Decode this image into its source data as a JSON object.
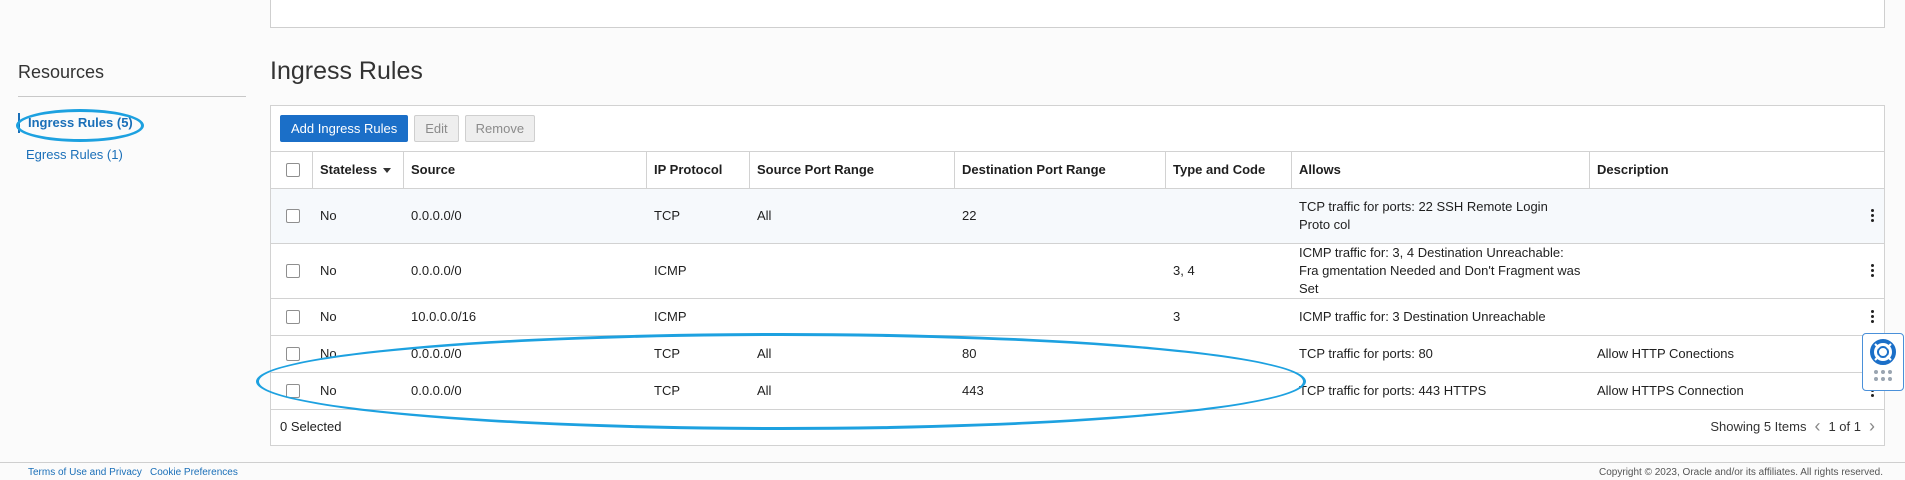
{
  "sidebar": {
    "title": "Resources",
    "items": [
      {
        "label": "Ingress Rules (5)"
      },
      {
        "label": "Egress Rules (1)"
      }
    ]
  },
  "section_title": "Ingress Rules",
  "toolbar": {
    "add_label": "Add Ingress Rules",
    "edit_label": "Edit",
    "remove_label": "Remove"
  },
  "table": {
    "headers": {
      "stateless": "Stateless",
      "source": "Source",
      "protocol": "IP Protocol",
      "src_port": "Source Port Range",
      "dst_port": "Destination Port Range",
      "type_code": "Type and Code",
      "allows": "Allows",
      "description": "Description"
    },
    "rows": [
      {
        "stateless": "No",
        "source": "0.0.0.0/0",
        "protocol": "TCP",
        "src_port": "All",
        "dst_port": "22",
        "type_code": "",
        "allows": "TCP traffic for ports: 22 SSH Remote Login Proto col",
        "description": ""
      },
      {
        "stateless": "No",
        "source": "0.0.0.0/0",
        "protocol": "ICMP",
        "src_port": "",
        "dst_port": "",
        "type_code": "3, 4",
        "allows": "ICMP traffic for: 3, 4 Destination Unreachable: Fra gmentation Needed and Don't Fragment was Set",
        "description": ""
      },
      {
        "stateless": "No",
        "source": "10.0.0.0/16",
        "protocol": "ICMP",
        "src_port": "",
        "dst_port": "",
        "type_code": "3",
        "allows": "ICMP traffic for: 3 Destination Unreachable",
        "description": ""
      },
      {
        "stateless": "No",
        "source": "0.0.0.0/0",
        "protocol": "TCP",
        "src_port": "All",
        "dst_port": "80",
        "type_code": "",
        "allows": "TCP traffic for ports: 80",
        "description": "Allow HTTP Conections"
      },
      {
        "stateless": "No",
        "source": "0.0.0.0/0",
        "protocol": "TCP",
        "src_port": "All",
        "dst_port": "443",
        "type_code": "",
        "allows": "TCP traffic for ports: 443 HTTPS",
        "description": "Allow HTTPS Connection"
      }
    ],
    "selected_text": "0 Selected",
    "showing_text": "Showing 5 Items",
    "page_text": "1 of 1"
  },
  "footer": {
    "left_links": [
      "Terms of Use and Privacy",
      "Cookie Preferences"
    ],
    "copyright": "Copyright © 2023, Oracle and/or its affiliates. All rights reserved."
  },
  "colors": {
    "accent": "#1b6fc8",
    "annotation": "#1da1e0"
  }
}
